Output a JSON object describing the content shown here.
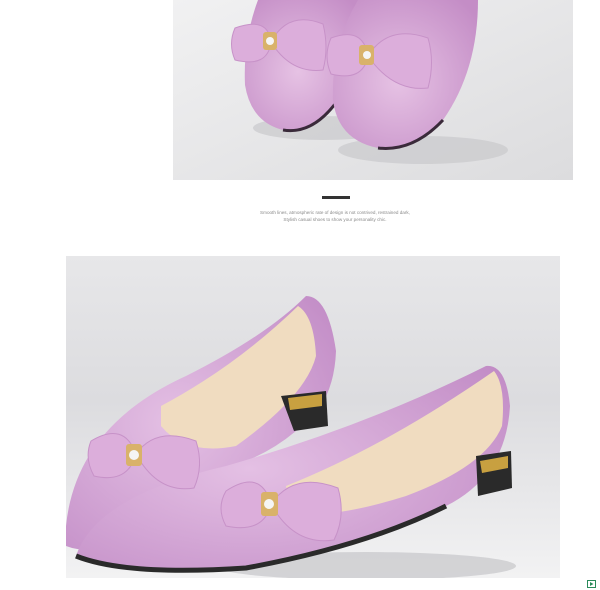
{
  "product_images": [
    {
      "name": "lilac-glitter-flats-toe-closeup",
      "colors": {
        "shoe": "#d7a8d6",
        "background": "#e9e9ea"
      }
    },
    {
      "name": "lilac-glitter-flats-side-view",
      "colors": {
        "shoe": "#d5a6d6",
        "background": "#dfdfe2",
        "insole": "#f0dcc0",
        "heel_accent": "#c8a040"
      }
    }
  ],
  "caption": {
    "line1": "Smooth lines, atmospheric rate of design is not contrived, restrained dark,",
    "line2": "Stylish casual shoes to show your personality chic."
  },
  "icons": {
    "corner": "play-icon"
  }
}
